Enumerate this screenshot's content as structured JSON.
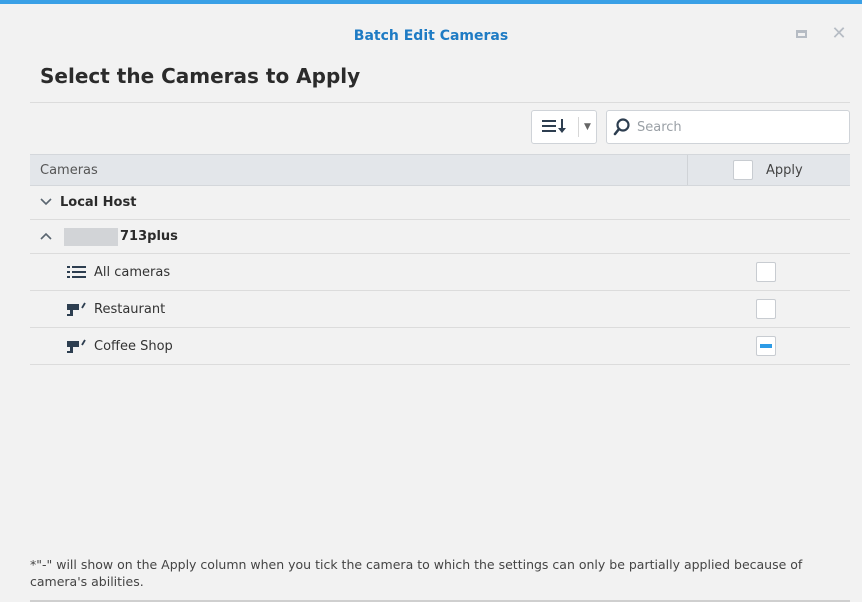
{
  "window": {
    "title": "Batch Edit Cameras",
    "accent_color": "#3aa0e6"
  },
  "heading": "Select the Cameras to Apply",
  "toolbar": {
    "sort_icon": "sort-icon",
    "search_placeholder": "Search"
  },
  "table": {
    "col_cameras": "Cameras",
    "col_apply": "Apply"
  },
  "groups": [
    {
      "label": "Local Host",
      "expanded": false
    },
    {
      "label": "713plus",
      "expanded": true
    }
  ],
  "rows": [
    {
      "label": "All cameras",
      "icon": "list-icon",
      "apply": "unchecked"
    },
    {
      "label": "Restaurant",
      "icon": "camera-icon",
      "apply": "unchecked"
    },
    {
      "label": "Coffee Shop",
      "icon": "camera-icon",
      "apply": "partial"
    }
  ],
  "footnote": "*\"-\" will show on the Apply column when you tick the camera to which the settings can only be partially applied because of camera's abilities."
}
